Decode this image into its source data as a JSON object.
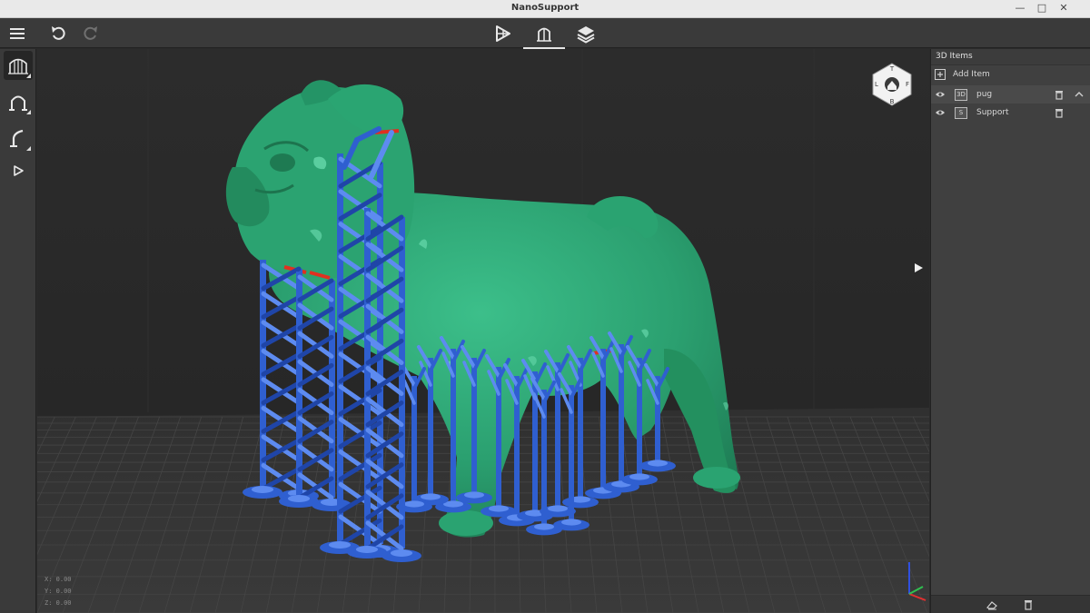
{
  "window": {
    "title": "NanoSupport"
  },
  "panel": {
    "header": "3D Items",
    "add_item": "Add Item",
    "items": [
      {
        "badge": "3D",
        "label": "pug"
      },
      {
        "badge": "S",
        "label": "Support"
      }
    ]
  },
  "coords": {
    "x": "X:  0.00",
    "y": "Y:  0.00",
    "z": "Z:  0.00"
  },
  "colors": {
    "model": "#2fa676",
    "support": "#2f5fd0",
    "contact": "#e03020",
    "background": "#282828",
    "panel": "#404040"
  },
  "icons": {
    "menu": "hamburger-icon",
    "undo": "undo-icon",
    "redo": "redo-icon",
    "orient": "orient-icon",
    "support_mode": "support-icon",
    "slice": "layers-icon",
    "view_cube": "view-cube-icon"
  }
}
